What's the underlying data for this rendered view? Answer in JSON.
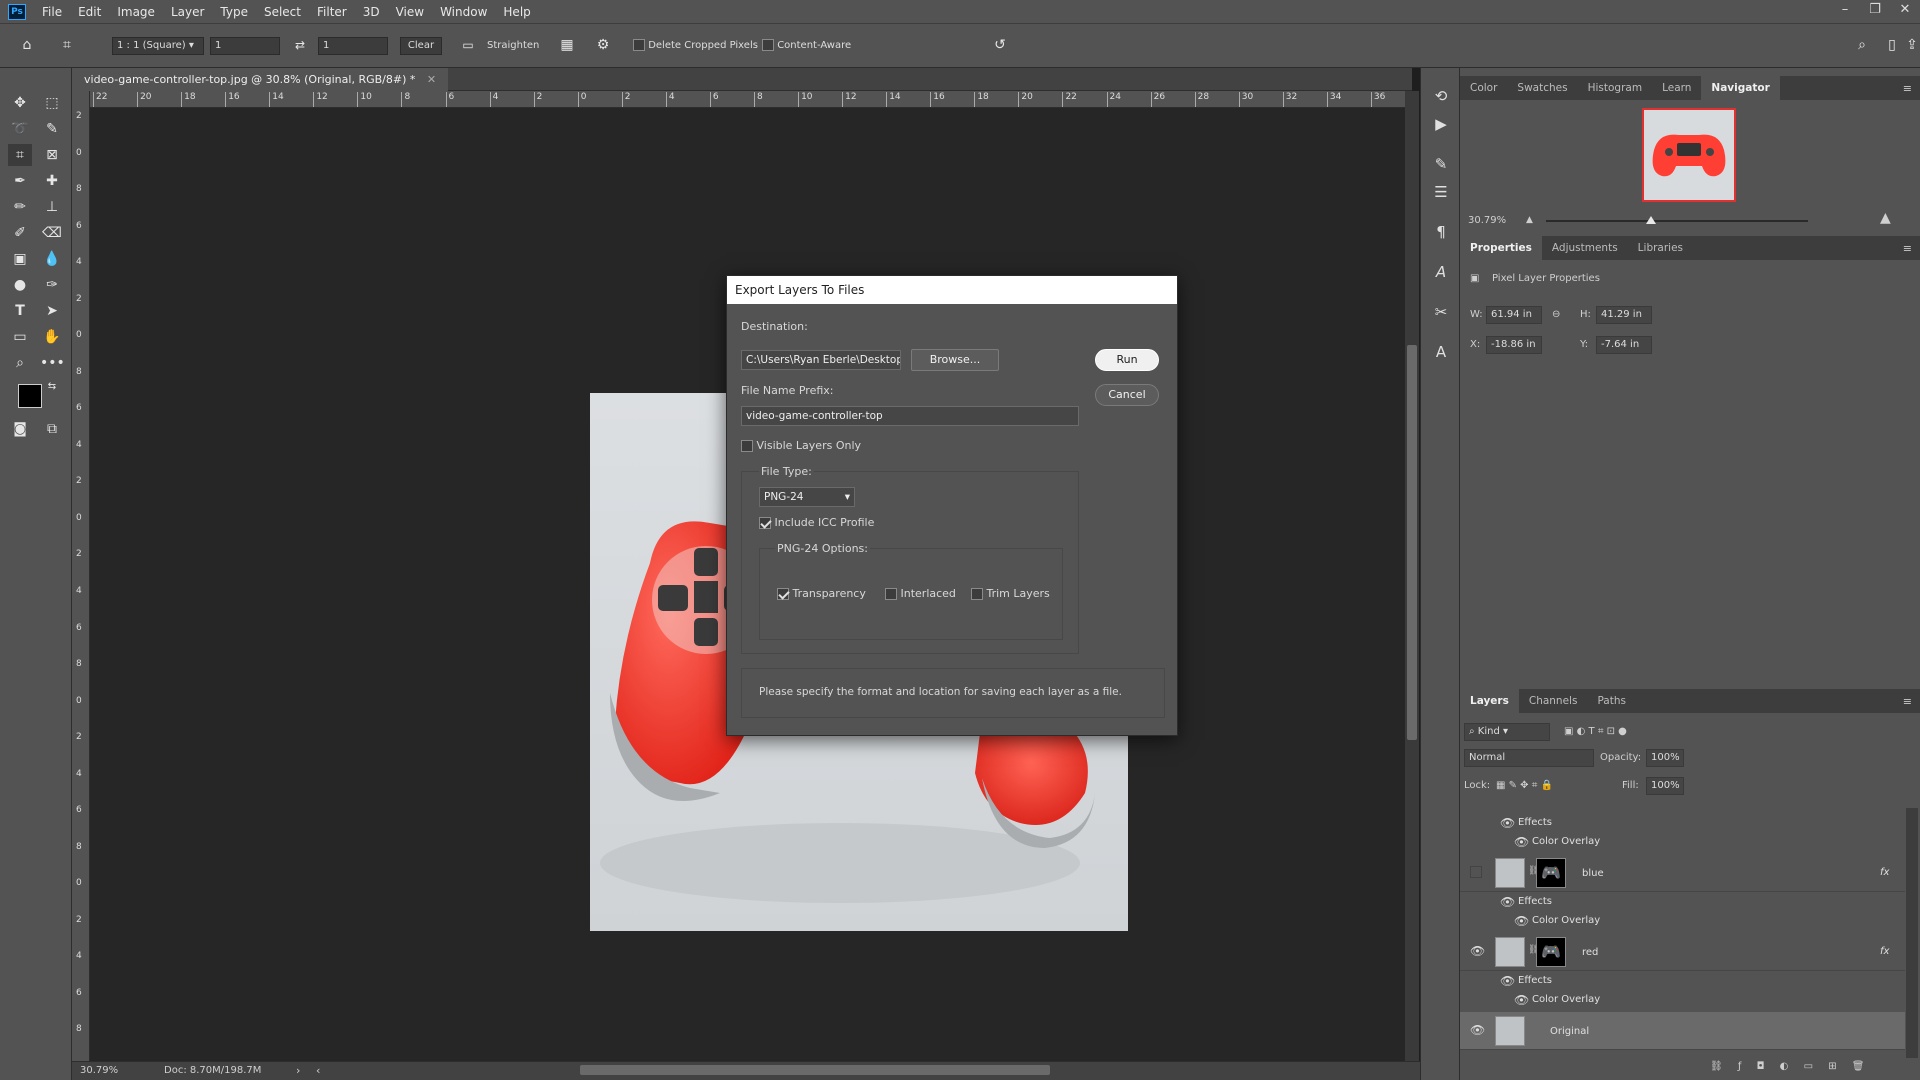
{
  "menubar": {
    "logo": "Ps",
    "items": [
      "File",
      "Edit",
      "Image",
      "Layer",
      "Type",
      "Select",
      "Filter",
      "3D",
      "View",
      "Window",
      "Help"
    ],
    "window_controls": [
      "–",
      "❐",
      "✕"
    ]
  },
  "options": {
    "ratio": "1 : 1 (Square)",
    "ratio_w": "1",
    "ratio_h": "1",
    "clear": "Clear",
    "straighten": "Straighten",
    "delete_cropped": "Delete Cropped Pixels",
    "content_aware": "Content-Aware"
  },
  "document": {
    "tab_title": "video-game-controller-top.jpg @ 30.8% (Original, RGB/8#) *",
    "zoom": "30.79%",
    "doc_size": "Doc: 8.70M/198.7M",
    "ruler_h": [
      "22",
      "20",
      "18",
      "16",
      "14",
      "12",
      "10",
      "8",
      "6",
      "4",
      "2",
      "0",
      "2",
      "4",
      "6",
      "8",
      "10",
      "12",
      "14",
      "16",
      "18",
      "20",
      "22",
      "24",
      "26",
      "28",
      "30",
      "32",
      "34",
      "36"
    ],
    "ruler_v": [
      "2",
      "0",
      "8",
      "6",
      "4",
      "2",
      "0",
      "8",
      "6",
      "4",
      "2",
      "0",
      "2",
      "4",
      "6",
      "8",
      "0",
      "2",
      "4",
      "6",
      "8",
      "0",
      "2",
      "4",
      "6",
      "8"
    ]
  },
  "dialog": {
    "title": "Export Layers To Files",
    "destination_label": "Destination:",
    "destination_value": "C:\\Users\\Ryan Eberle\\Desktop\\",
    "browse": "Browse...",
    "run": "Run",
    "cancel": "Cancel",
    "prefix_label": "File Name Prefix:",
    "prefix_value": "video-game-controller-top",
    "visible_only": "Visible Layers Only",
    "file_type_label": "File Type:",
    "file_type_value": "PNG-24",
    "icc": "Include ICC Profile",
    "options_label": "PNG-24 Options:",
    "transparency": "Transparency",
    "interlaced": "Interlaced",
    "trim": "Trim Layers",
    "message": "Please specify the format and location for saving each layer as a file."
  },
  "navigator": {
    "tabs": [
      "Color",
      "Swatches",
      "Histogram",
      "Learn",
      "Navigator"
    ],
    "active_tab": "Navigator",
    "zoom": "30.79%",
    "zoom_fraction": 0.4
  },
  "properties": {
    "tabs": [
      "Properties",
      "Adjustments",
      "Libraries"
    ],
    "header": "Pixel Layer Properties",
    "w_label": "W:",
    "w": "61.94 in",
    "h_label": "H:",
    "h": "41.29 in",
    "x_label": "X:",
    "x": "-18.86 in",
    "y_label": "Y:",
    "y": "-7.64 in"
  },
  "layers": {
    "tabs": [
      "Layers",
      "Channels",
      "Paths"
    ],
    "kind": "Kind",
    "blend": "Normal",
    "opacity_label": "Opacity:",
    "opacity": "100%",
    "lock_label": "Lock:",
    "fill_label": "Fill:",
    "fill": "100%",
    "effects": "Effects",
    "color_overlay": "Color Overlay",
    "items": [
      {
        "name": "blue"
      },
      {
        "name": "red"
      },
      {
        "name": "Original"
      }
    ],
    "fx": "fx"
  },
  "colors": {
    "accent_red": "#ff4a3d",
    "panel": "#535353"
  }
}
